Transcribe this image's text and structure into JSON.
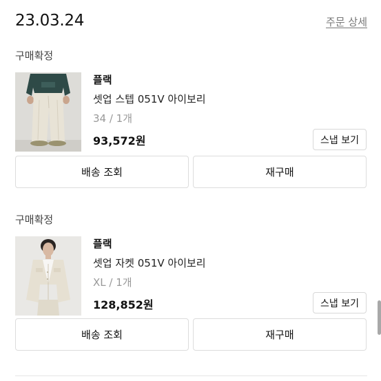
{
  "header": {
    "order_date": "23.03.24",
    "order_detail_link": "주문 상세"
  },
  "orders": [
    {
      "status": "구매확정",
      "brand": "플랙",
      "product_name": "셋업 스텝 051V 아이보리",
      "option": "34 / 1개",
      "price": "93,572원",
      "snap_button": "스냅 보기",
      "track_button": "배송 조회",
      "rebuy_button": "재구매"
    },
    {
      "status": "구매확정",
      "brand": "플랙",
      "product_name": "셋업 자켓 051V 아이보리",
      "option": "XL / 1개",
      "price": "128,852원",
      "snap_button": "스냅 보기",
      "track_button": "배송 조회",
      "rebuy_button": "재구매"
    }
  ]
}
